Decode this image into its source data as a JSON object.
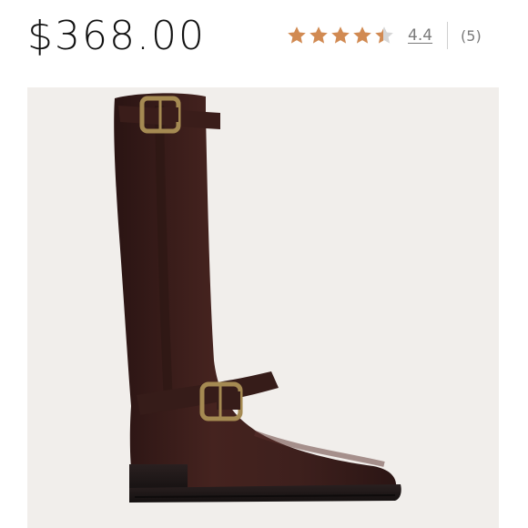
{
  "product": {
    "price": "$368.00",
    "rating": {
      "value_label": "4.4",
      "value": 4.4,
      "max": 5,
      "review_count_label": "(5)",
      "star_color": "#d18a52",
      "empty_star_color": "#d6d6d6"
    },
    "image": {
      "icon": "boot-image",
      "background_color": "#f1eeeb",
      "boot_color": "#3b1f1c",
      "buckle_color": "#a58a52"
    }
  }
}
